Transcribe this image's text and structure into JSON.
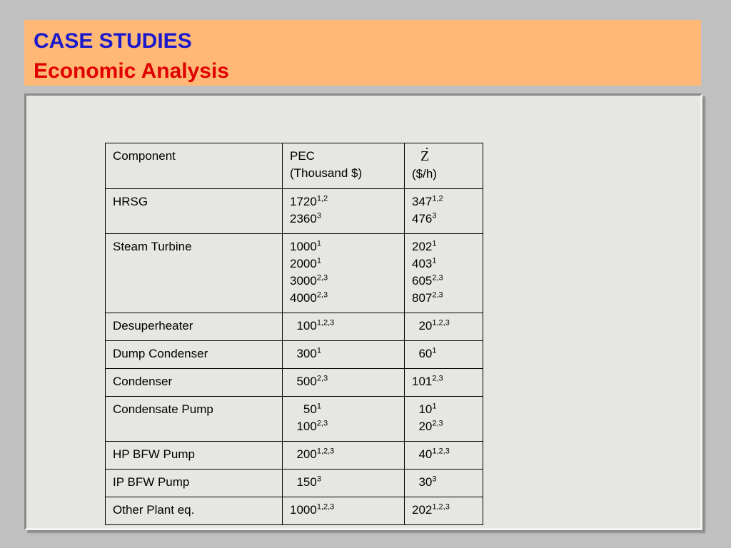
{
  "header": {
    "title": "CASE STUDIES",
    "subtitle": "Economic Analysis"
  },
  "table": {
    "headers": [
      {
        "lines": [
          "Component"
        ]
      },
      {
        "lines": [
          "PEC",
          "(Thousand $)"
        ]
      },
      {
        "symbol": "Z",
        "lines": [
          "($/h)"
        ]
      }
    ],
    "rows": [
      {
        "component": "HRSG",
        "pec": [
          {
            "v": "1720",
            "s": "1,2"
          },
          {
            "v": "2360",
            "s": "3"
          }
        ],
        "z": [
          {
            "v": "347",
            "s": "1,2"
          },
          {
            "v": "476",
            "s": "3"
          }
        ]
      },
      {
        "component": "Steam Turbine",
        "pec": [
          {
            "v": "1000",
            "s": "1"
          },
          {
            "v": "2000",
            "s": "1"
          },
          {
            "v": "3000",
            "s": "2,3"
          },
          {
            "v": "4000",
            "s": "2,3"
          }
        ],
        "z": [
          {
            "v": "202",
            "s": "1"
          },
          {
            "v": "403",
            "s": "1"
          },
          {
            "v": "605",
            "s": "2,3"
          },
          {
            "v": "807",
            "s": "2,3"
          }
        ]
      },
      {
        "component": "Desuperheater",
        "pec": [
          {
            "v": "  100",
            "s": "1,2,3"
          }
        ],
        "z": [
          {
            "v": "  20",
            "s": "1,2,3"
          }
        ]
      },
      {
        "component": "Dump Condenser",
        "pec": [
          {
            "v": "  300",
            "s": "1"
          }
        ],
        "z": [
          {
            "v": "  60",
            "s": "1"
          }
        ]
      },
      {
        "component": "Condenser",
        "pec": [
          {
            "v": "  500",
            "s": "2,3"
          }
        ],
        "z": [
          {
            "v": "101",
            "s": "2,3"
          }
        ]
      },
      {
        "component": "Condensate Pump",
        "pec": [
          {
            "v": "    50",
            "s": "1"
          },
          {
            "v": "  100",
            "s": "2,3"
          }
        ],
        "z": [
          {
            "v": "  10",
            "s": "1"
          },
          {
            "v": "  20",
            "s": "2,3"
          }
        ]
      },
      {
        "component": "HP BFW Pump",
        "pec": [
          {
            "v": "  200",
            "s": "1,2,3"
          }
        ],
        "z": [
          {
            "v": "  40",
            "s": "1,2,3"
          }
        ]
      },
      {
        "component": "IP BFW Pump",
        "pec": [
          {
            "v": "  150",
            "s": "3"
          }
        ],
        "z": [
          {
            "v": "  30",
            "s": "3"
          }
        ]
      },
      {
        "component": "Other Plant eq.",
        "pec": [
          {
            "v": "1000",
            "s": "1,2,3"
          }
        ],
        "z": [
          {
            "v": "202",
            "s": "1,2,3"
          }
        ]
      }
    ]
  },
  "colors": {
    "header_bg": "#ffb875",
    "title": "#1a1acc",
    "subtitle": "#e00000",
    "panel_bg": "#e6e6e2",
    "page_bg": "#c0c0c0"
  }
}
